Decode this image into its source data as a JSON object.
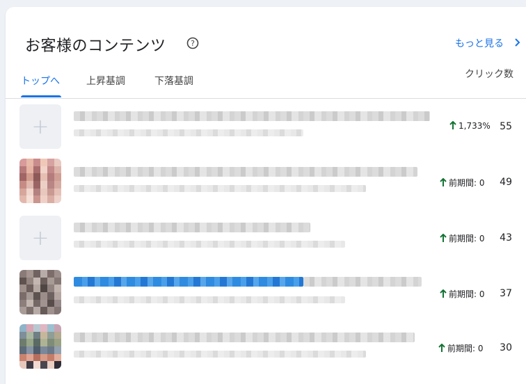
{
  "card": {
    "title": "お客様のコンテンツ",
    "more_link": "もっと見る"
  },
  "tabs": [
    {
      "label": "トップへ",
      "active": true
    },
    {
      "label": "上昇基調",
      "active": false
    },
    {
      "label": "下落基調",
      "active": false
    }
  ],
  "column_header": "クリック数",
  "colors": {
    "accent": "#1a73e8",
    "up_arrow": "#137333"
  },
  "rows": [
    {
      "thumbnail": "placeholder",
      "change": "1,733%",
      "clicks": "55"
    },
    {
      "thumbnail": "image",
      "change": "前期間: 0",
      "clicks": "49"
    },
    {
      "thumbnail": "placeholder",
      "change": "前期間: 0",
      "clicks": "43"
    },
    {
      "thumbnail": "image",
      "change": "前期間: 0",
      "clicks": "37"
    },
    {
      "thumbnail": "image",
      "change": "前期間: 0",
      "clicks": "30"
    }
  ]
}
